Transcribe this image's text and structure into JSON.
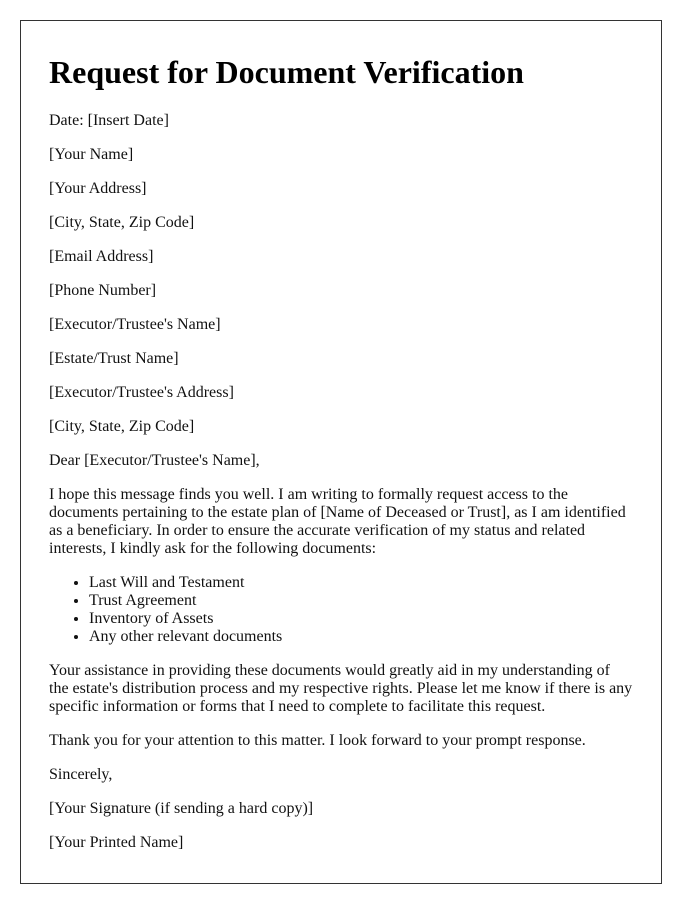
{
  "title": "Request for Document Verification",
  "header_lines": [
    "Date: [Insert Date]",
    "[Your Name]",
    "[Your Address]",
    "[City, State, Zip Code]",
    "[Email Address]",
    "[Phone Number]",
    "[Executor/Trustee's Name]",
    "[Estate/Trust Name]",
    "[Executor/Trustee's Address]",
    "[City, State, Zip Code]"
  ],
  "salutation": "Dear [Executor/Trustee's Name],",
  "intro": "I hope this message finds you well. I am writing to formally request access to the documents pertaining to the estate plan of [Name of Deceased or Trust], as I am identified as a beneficiary. In order to ensure the accurate verification of my status and related interests, I kindly ask for the following documents:",
  "documents": [
    "Last Will and Testament",
    "Trust Agreement",
    "Inventory of Assets",
    "Any other relevant documents"
  ],
  "body2": "Your assistance in providing these documents would greatly aid in my understanding of the estate's distribution process and my respective rights. Please let me know if there is any specific information or forms that I need to complete to facilitate this request.",
  "thanks": "Thank you for your attention to this matter. I look forward to your prompt response.",
  "closing": "Sincerely,",
  "signature": "[Your Signature (if sending a hard copy)]",
  "printed_name": "[Your Printed Name]"
}
